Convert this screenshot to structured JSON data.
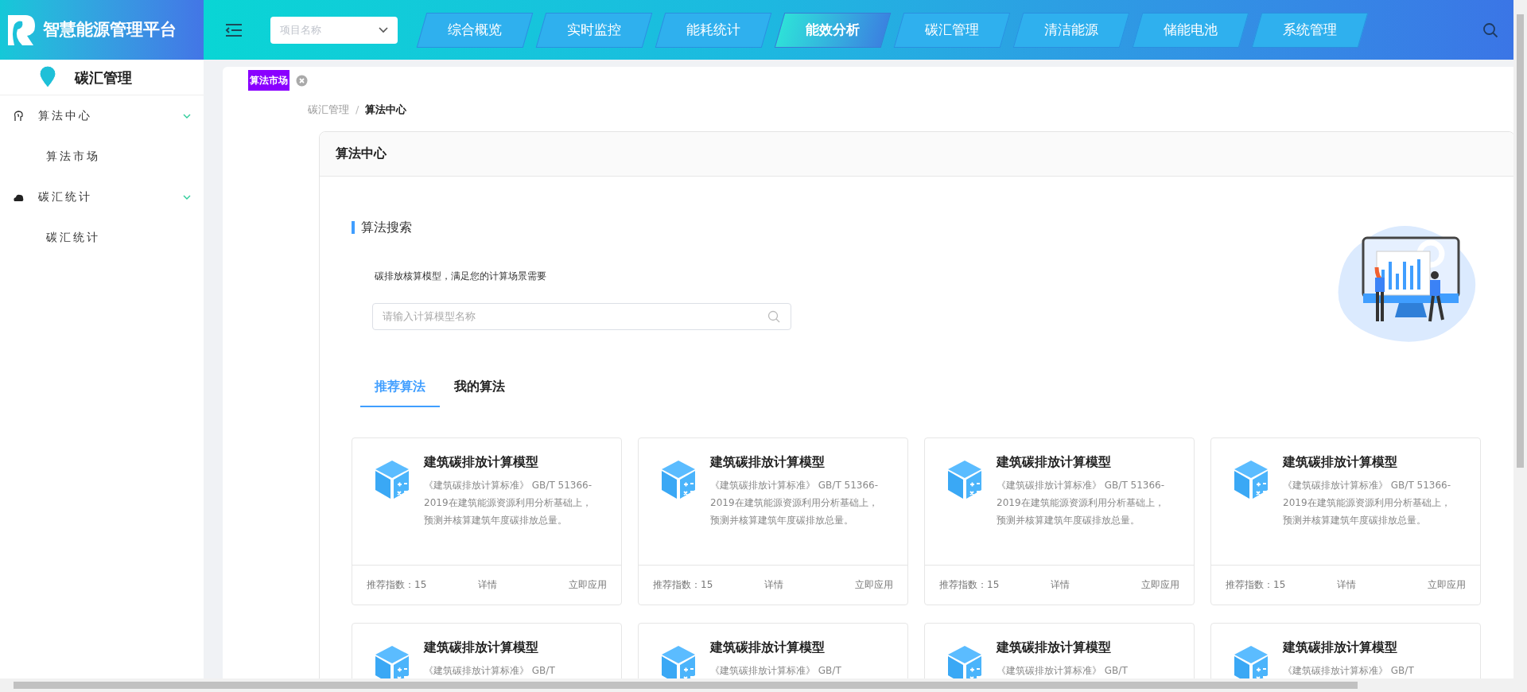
{
  "header": {
    "brand": "智慧能源管理平台",
    "project_select": {
      "placeholder": "项目名称"
    },
    "nav": [
      {
        "label": "综合概览",
        "selected": false
      },
      {
        "label": "实时监控",
        "selected": false
      },
      {
        "label": "能耗统计",
        "selected": false
      },
      {
        "label": "能效分析",
        "selected": true
      },
      {
        "label": "碳汇管理",
        "selected": false
      },
      {
        "label": "清洁能源",
        "selected": false
      },
      {
        "label": "储能电池",
        "selected": false
      },
      {
        "label": "系统管理",
        "selected": false
      }
    ]
  },
  "sidebar": {
    "title": "碳汇管理",
    "items": [
      {
        "label": "算法中心",
        "expanded": true,
        "children": [
          {
            "label": "算法市场"
          }
        ]
      },
      {
        "label": "碳汇统计",
        "expanded": true,
        "children": [
          {
            "label": "碳汇统计"
          }
        ]
      }
    ]
  },
  "open_tab": "算法市场",
  "breadcrumb": [
    "碳汇管理",
    "算法中心"
  ],
  "breadcrumb_separator": "/",
  "panel": {
    "title": "算法中心",
    "section_title": "算法搜索",
    "subtitle": "碳排放核算模型，满足您的计算场景需要",
    "search": {
      "placeholder": "请输入计算模型名称"
    },
    "tabs": [
      {
        "label": "推荐算法",
        "selected": true
      },
      {
        "label": "我的算法",
        "selected": false
      }
    ],
    "cards": [
      {
        "title": "建筑碳排放计算模型",
        "description": "《建筑碳排放计算标准》 GB/T 51366-2019在建筑能源资源利用分析基础上，预测并核算建筑年度碳排放总量。",
        "score": "推荐指数：15",
        "details": "详情",
        "apply": "立即应用"
      },
      {
        "title": "建筑碳排放计算模型",
        "description": "《建筑碳排放计算标准》 GB/T 51366-2019在建筑能源资源利用分析基础上，预测并核算建筑年度碳排放总量。",
        "score": "推荐指数：15",
        "details": "详情",
        "apply": "立即应用"
      },
      {
        "title": "建筑碳排放计算模型",
        "description": "《建筑碳排放计算标准》 GB/T 51366-2019在建筑能源资源利用分析基础上，预测并核算建筑年度碳排放总量。",
        "score": "推荐指数：15",
        "details": "详情",
        "apply": "立即应用"
      },
      {
        "title": "建筑碳排放计算模型",
        "description": "《建筑碳排放计算标准》 GB/T 51366-2019在建筑能源资源利用分析基础上，预测并核算建筑年度碳排放总量。",
        "score": "推荐指数：15",
        "details": "详情",
        "apply": "立即应用"
      },
      {
        "title": "建筑碳排放计算模型",
        "description": "《建筑碳排放计算标准》 GB/T"
      },
      {
        "title": "建筑碳排放计算模型",
        "description": "《建筑碳排放计算标准》 GB/T"
      },
      {
        "title": "建筑碳排放计算模型",
        "description": "《建筑碳排放计算标准》 GB/T"
      },
      {
        "title": "建筑碳排放计算模型",
        "description": "《建筑碳排放计算标准》 GB/T"
      }
    ]
  }
}
